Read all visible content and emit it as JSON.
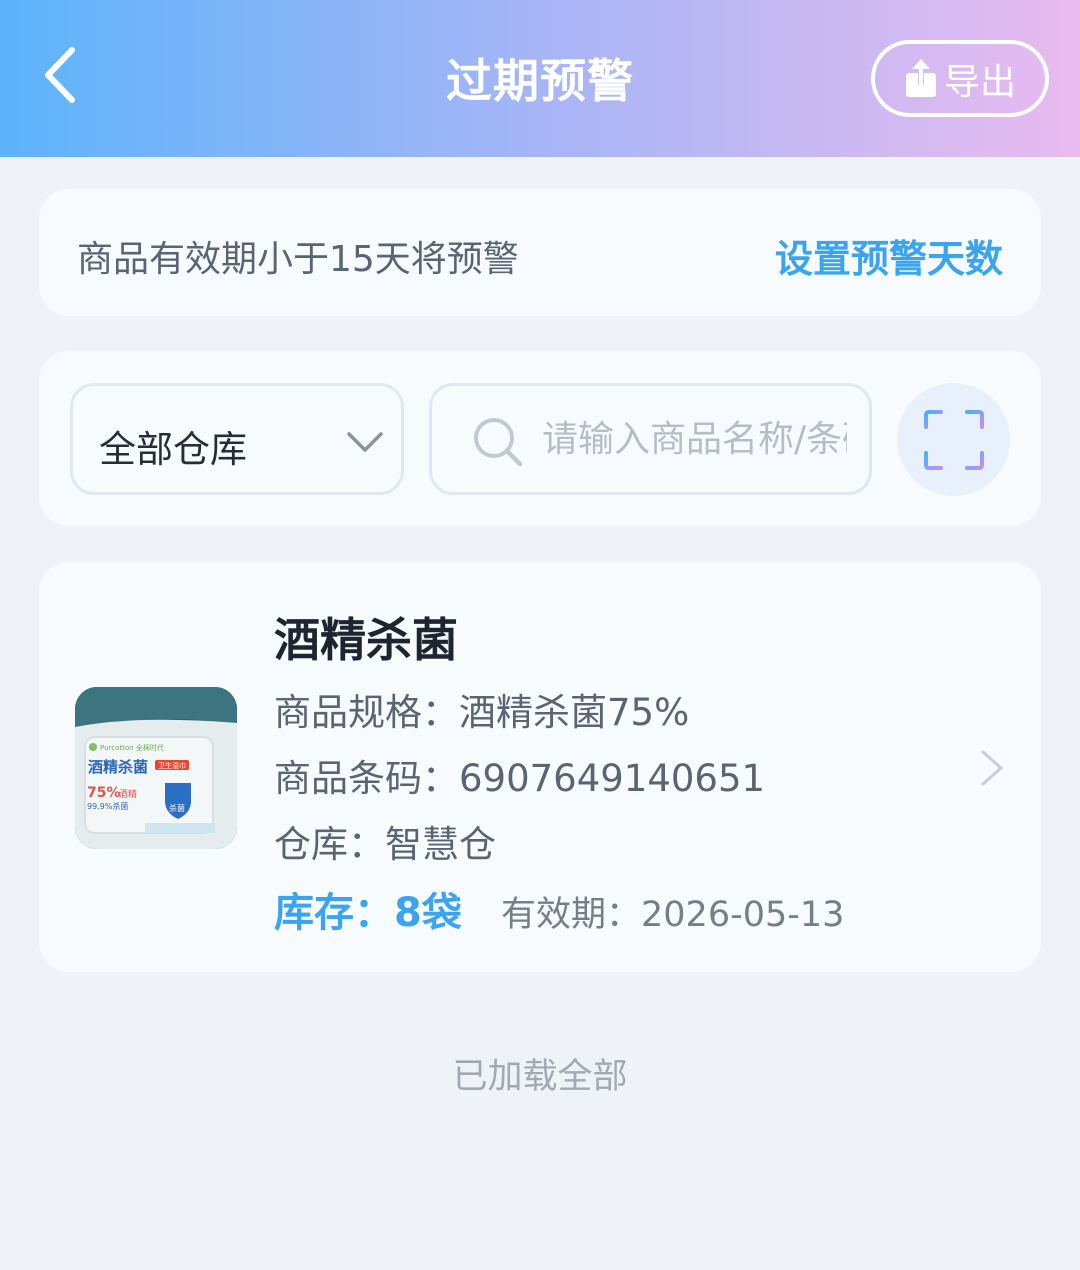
{
  "header": {
    "title": "过期预警",
    "export_label": "导出"
  },
  "notice": {
    "text": "商品有效期小于15天将预警",
    "link": "设置预警天数"
  },
  "filter": {
    "warehouse_value": "全部仓库",
    "search_placeholder": "请输入商品名称/条码"
  },
  "product": {
    "name": "酒精杀菌",
    "spec_label": "商品规格：",
    "spec_value": "酒精杀菌75%",
    "barcode_label": "商品条码：",
    "barcode_value": "6907649140651",
    "warehouse_label": "仓库：",
    "warehouse_value": "智慧仓",
    "stock_label": "库存：",
    "stock_value": "8袋",
    "expiry_label": "有效期：",
    "expiry_value": "2026-05-13",
    "image_text": {
      "brand": "Purcotton 全棉时代",
      "title": "酒精杀菌",
      "tag": "卫生湿巾",
      "percent": "75%",
      "percent_suffix": "酒精",
      "kill": "99.9%杀菌",
      "badge": "杀菌"
    }
  },
  "footer": {
    "loaded_text": "已加载全部"
  },
  "colors": {
    "accent": "#3aa5ee",
    "header_start": "#5cb4fb",
    "header_end": "#e8bbef",
    "background": "#eff3f8"
  },
  "icons": [
    "back-arrow-icon",
    "export-icon",
    "chevron-down-icon",
    "search-icon",
    "scan-icon",
    "chevron-right-icon"
  ]
}
